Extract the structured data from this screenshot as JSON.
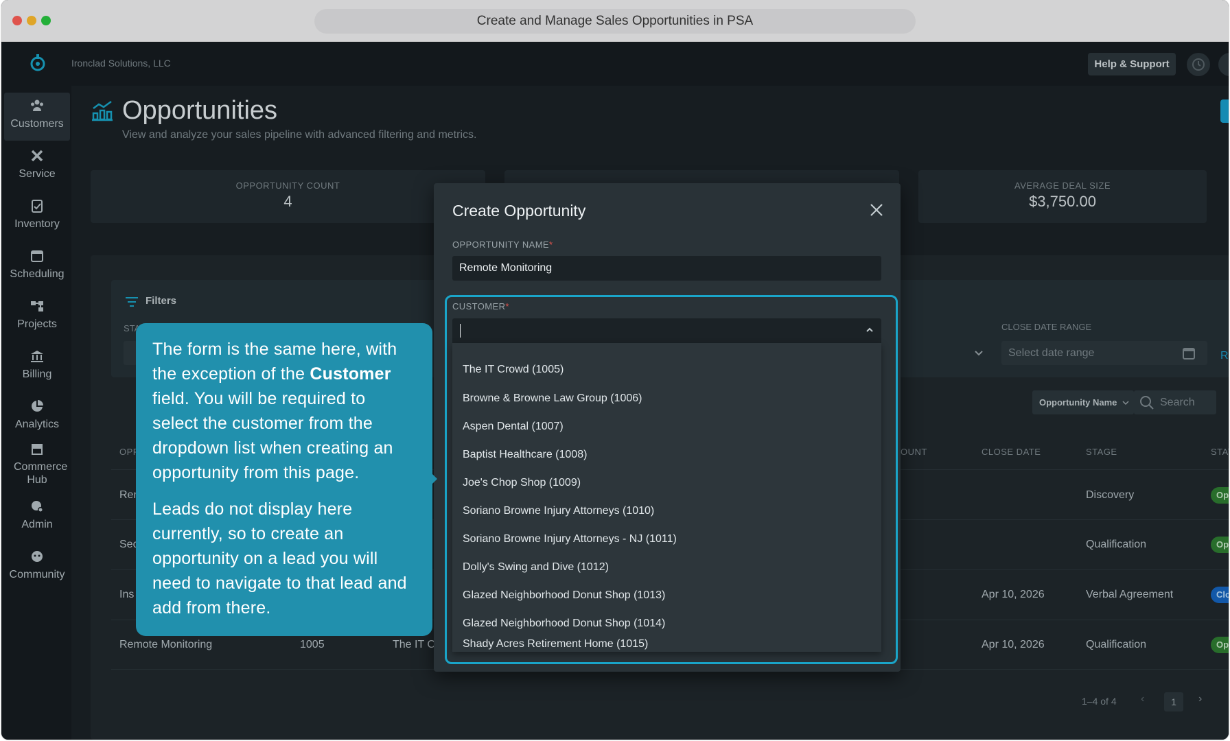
{
  "window_title": "Create and Manage Sales Opportunities in PSA",
  "topbar": {
    "company": "Ironclad Solutions, LLC",
    "help_label": "Help & Support"
  },
  "sidebar": {
    "items": [
      {
        "label": "Customers",
        "icon": "customers-icon"
      },
      {
        "label": "Service",
        "icon": "service-icon"
      },
      {
        "label": "Inventory",
        "icon": "inventory-icon"
      },
      {
        "label": "Scheduling",
        "icon": "calendar-icon"
      },
      {
        "label": "Projects",
        "icon": "projects-icon"
      },
      {
        "label": "Billing",
        "icon": "bank-icon"
      },
      {
        "label": "Analytics",
        "icon": "pie-chart-icon"
      },
      {
        "label": "Commerce Hub",
        "icon": "store-icon"
      },
      {
        "label": "Admin",
        "icon": "admin-icon"
      },
      {
        "label": "Community",
        "icon": "community-icon"
      }
    ]
  },
  "page": {
    "title": "Opportunities",
    "subtitle": "View and analyze your sales pipeline with advanced filtering and metrics."
  },
  "stats": [
    {
      "label": "OPPORTUNITY COUNT",
      "value": "4"
    },
    {
      "label": "AVERAGE DEAL SIZE",
      "value": "$3,750.00"
    }
  ],
  "filters": {
    "title": "Filters",
    "status_label_partial": "STA",
    "close_date_label": "CLOSE DATE RANGE",
    "date_placeholder": "Select date range",
    "reset_partial": "Re",
    "search_field": "Opportunity Name",
    "search_placeholder": "Search"
  },
  "table": {
    "headers": {
      "opp_partial": "OPP",
      "amount_partial": "OUNT",
      "close_date": "CLOSE DATE",
      "stage": "STAGE",
      "status_partial": "STAT"
    },
    "rows": [
      {
        "name": "Rem",
        "number": "",
        "customer": "",
        "close_date": "",
        "stage": "Discovery",
        "status": "Ope"
      },
      {
        "name": "Sec",
        "number": "",
        "customer": "",
        "close_date": "",
        "stage": "Qualification",
        "status": "Ope"
      },
      {
        "name": "Ins",
        "number": "",
        "customer": "",
        "close_date": "Apr 10, 2026",
        "stage": "Verbal Agreement",
        "status": "Clo"
      },
      {
        "name": "Remote Monitoring",
        "number": "1005",
        "customer": "The IT C",
        "close_date": "Apr 10, 2026",
        "stage": "Qualification",
        "status": "Ope"
      }
    ],
    "pagination": "1–4 of 4",
    "page": "1"
  },
  "modal": {
    "title": "Create Opportunity",
    "opportunity_name_label": "OPPORTUNITY NAME",
    "opportunity_name_value": "Remote Monitoring",
    "customer_label": "CUSTOMER",
    "required_mark": "*",
    "customer_options": [
      "The IT Crowd (1005)",
      "Browne & Browne Law Group (1006)",
      "Aspen Dental (1007)",
      "Baptist Healthcare (1008)",
      "Joe's Chop Shop (1009)",
      "Soriano Browne Injury Attorneys (1010)",
      "Soriano Browne Injury Attorneys - NJ (1011)",
      "Dolly's Swing and Dive (1012)",
      "Glazed Neighborhood Donut Shop (1013)",
      "Glazed Neighborhood Donut Shop (1014)",
      "Shady Acres Retirement Home (1015)"
    ]
  },
  "callout": {
    "p1_a": "The form is the same here, with the exception of the ",
    "p1_bold": "Customer",
    "p1_b": " field. You will be required to select the customer from the dropdown list when creating an opportunity from this page.",
    "p2": "Leads do not display here currently, so to create an opportunity on a lead you will need to navigate to that lead and add from there."
  },
  "colors": {
    "accent": "#1aa5c9",
    "callout": "#2190ad",
    "open_badge": "#2e7d32",
    "closed_badge": "#1565c0"
  }
}
